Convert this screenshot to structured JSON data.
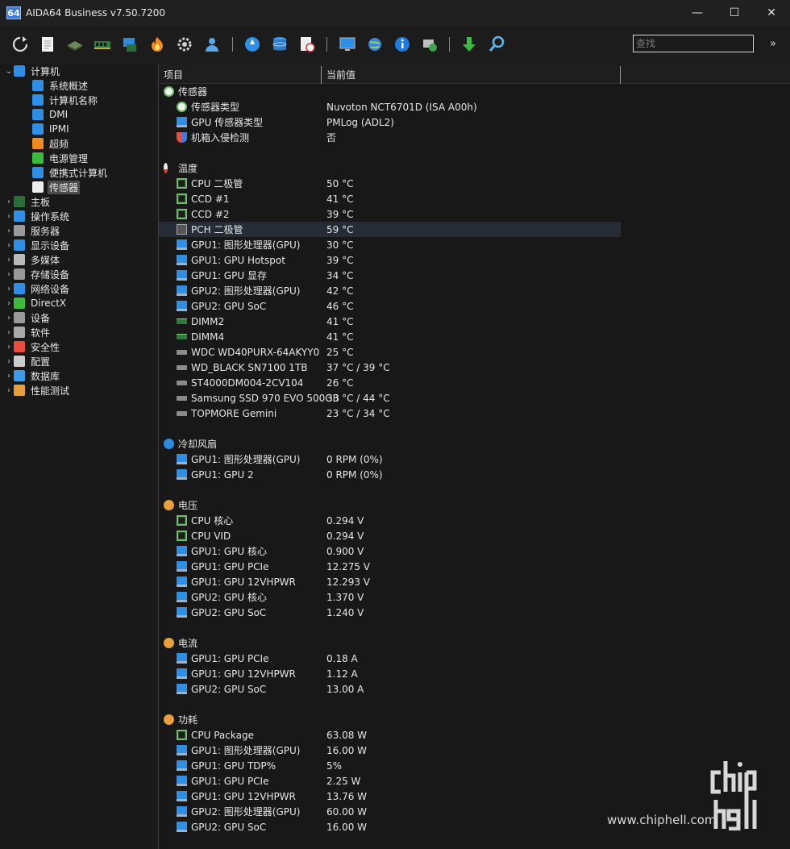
{
  "window": {
    "icon_text": "64",
    "title": "AIDA64 Business v7.50.7200",
    "minimize": "—",
    "maximize": "☐",
    "close": "✕"
  },
  "toolbar": {
    "search_placeholder": "查找",
    "more": "»"
  },
  "tree": {
    "root_label": "计算机",
    "children": [
      {
        "label": "系统概述"
      },
      {
        "label": "计算机名称"
      },
      {
        "label": "DMI"
      },
      {
        "label": "IPMI"
      },
      {
        "label": "超频"
      },
      {
        "label": "电源管理"
      },
      {
        "label": "便携式计算机"
      },
      {
        "label": "传感器",
        "selected": true
      }
    ],
    "top_items": [
      {
        "label": "主板"
      },
      {
        "label": "操作系统"
      },
      {
        "label": "服务器"
      },
      {
        "label": "显示设备"
      },
      {
        "label": "多媒体"
      },
      {
        "label": "存储设备"
      },
      {
        "label": "网络设备"
      },
      {
        "label": "DirectX"
      },
      {
        "label": "设备"
      },
      {
        "label": "软件"
      },
      {
        "label": "安全性"
      },
      {
        "label": "配置"
      },
      {
        "label": "数据库"
      },
      {
        "label": "性能测试"
      }
    ]
  },
  "table": {
    "col_item": "项目",
    "col_value": "当前值",
    "rows": [
      {
        "type": "section",
        "name": "传感器",
        "icon": "sensor-icon"
      },
      {
        "name": "传感器类型",
        "value": "Nuvoton NCT6701D  (ISA A00h)",
        "icon": "sensor-icon"
      },
      {
        "name": "GPU 传感器类型",
        "value": "PMLog  (ADL2)",
        "icon": "monitor-icon"
      },
      {
        "name": "机箱入侵检测",
        "value": "否",
        "icon": "shield-icon"
      },
      {
        "type": "blank"
      },
      {
        "type": "section",
        "name": "温度",
        "icon": "thermometer-icon"
      },
      {
        "name": "CPU 二极管",
        "value": "50 °C",
        "icon": "cpu-icon"
      },
      {
        "name": "CCD #1",
        "value": "41 °C",
        "icon": "cpu-icon"
      },
      {
        "name": "CCD #2",
        "value": "39 °C",
        "icon": "cpu-icon"
      },
      {
        "name": "PCH 二极管",
        "value": "59 °C",
        "icon": "chipset-icon",
        "highlight": true
      },
      {
        "name": "GPU1: 图形处理器(GPU)",
        "value": "30 °C",
        "icon": "monitor-icon"
      },
      {
        "name": "GPU1: GPU Hotspot",
        "value": "39 °C",
        "icon": "monitor-icon"
      },
      {
        "name": "GPU1: GPU 显存",
        "value": "34 °C",
        "icon": "monitor-icon"
      },
      {
        "name": "GPU2: 图形处理器(GPU)",
        "value": "42 °C",
        "icon": "monitor-icon"
      },
      {
        "name": "GPU2: GPU SoC",
        "value": "46 °C",
        "icon": "monitor-icon"
      },
      {
        "name": "DIMM2",
        "value": "41 °C",
        "icon": "memory-icon"
      },
      {
        "name": "DIMM4",
        "value": "41 °C",
        "icon": "memory-icon"
      },
      {
        "name": "WDC WD40PURX-64AKYY0",
        "value": "25 °C",
        "icon": "drive-icon"
      },
      {
        "name": "WD_BLACK SN7100 1TB",
        "value": "37 °C / 39 °C",
        "icon": "drive-icon"
      },
      {
        "name": "ST4000DM004-2CV104",
        "value": "26 °C",
        "icon": "drive-icon"
      },
      {
        "name": "Samsung SSD 970 EVO 500GB",
        "value": "33 °C / 44 °C",
        "icon": "drive-icon"
      },
      {
        "name": "TOPMORE Gemini",
        "value": "23 °C / 34 °C",
        "icon": "drive-icon"
      },
      {
        "type": "blank"
      },
      {
        "type": "section",
        "name": "冷却风扇",
        "icon": "fan-icon"
      },
      {
        "name": "GPU1: 图形处理器(GPU)",
        "value": "0 RPM  (0%)",
        "icon": "monitor-icon"
      },
      {
        "name": "GPU1: GPU 2",
        "value": "0 RPM  (0%)",
        "icon": "monitor-icon"
      },
      {
        "type": "blank"
      },
      {
        "type": "section",
        "name": "电压",
        "icon": "bolt-icon"
      },
      {
        "name": "CPU 核心",
        "value": "0.294 V",
        "icon": "cpu-icon"
      },
      {
        "name": "CPU VID",
        "value": "0.294 V",
        "icon": "cpu-icon"
      },
      {
        "name": "GPU1: GPU 核心",
        "value": "0.900 V",
        "icon": "monitor-icon"
      },
      {
        "name": "GPU1: GPU PCIe",
        "value": "12.275 V",
        "icon": "monitor-icon"
      },
      {
        "name": "GPU1: GPU 12VHPWR",
        "value": "12.293 V",
        "icon": "monitor-icon"
      },
      {
        "name": "GPU2: GPU 核心",
        "value": "1.370 V",
        "icon": "monitor-icon"
      },
      {
        "name": "GPU2: GPU SoC",
        "value": "1.240 V",
        "icon": "monitor-icon"
      },
      {
        "type": "blank"
      },
      {
        "type": "section",
        "name": "电流",
        "icon": "bolt-icon"
      },
      {
        "name": "GPU1: GPU PCIe",
        "value": "0.18 A",
        "icon": "monitor-icon"
      },
      {
        "name": "GPU1: GPU 12VHPWR",
        "value": "1.12 A",
        "icon": "monitor-icon"
      },
      {
        "name": "GPU2: GPU SoC",
        "value": "13.00 A",
        "icon": "monitor-icon"
      },
      {
        "type": "blank"
      },
      {
        "type": "section",
        "name": "功耗",
        "icon": "bolt-icon"
      },
      {
        "name": "CPU Package",
        "value": "63.08 W",
        "icon": "cpu-icon"
      },
      {
        "name": "GPU1: 图形处理器(GPU)",
        "value": "16.00 W",
        "icon": "monitor-icon"
      },
      {
        "name": "GPU1: GPU TDP%",
        "value": "5%",
        "icon": "monitor-icon"
      },
      {
        "name": "GPU1: GPU PCIe",
        "value": "2.25 W",
        "icon": "monitor-icon"
      },
      {
        "name": "GPU1: GPU 12VHPWR",
        "value": "13.76 W",
        "icon": "monitor-icon"
      },
      {
        "name": "GPU2: 图形处理器(GPU)",
        "value": "60.00 W",
        "icon": "monitor-icon"
      },
      {
        "name": "GPU2: GPU SoC",
        "value": "16.00 W",
        "icon": "monitor-icon"
      }
    ]
  },
  "watermark": {
    "url": "www.chiphell.com",
    "logo_text": "chip hell"
  }
}
